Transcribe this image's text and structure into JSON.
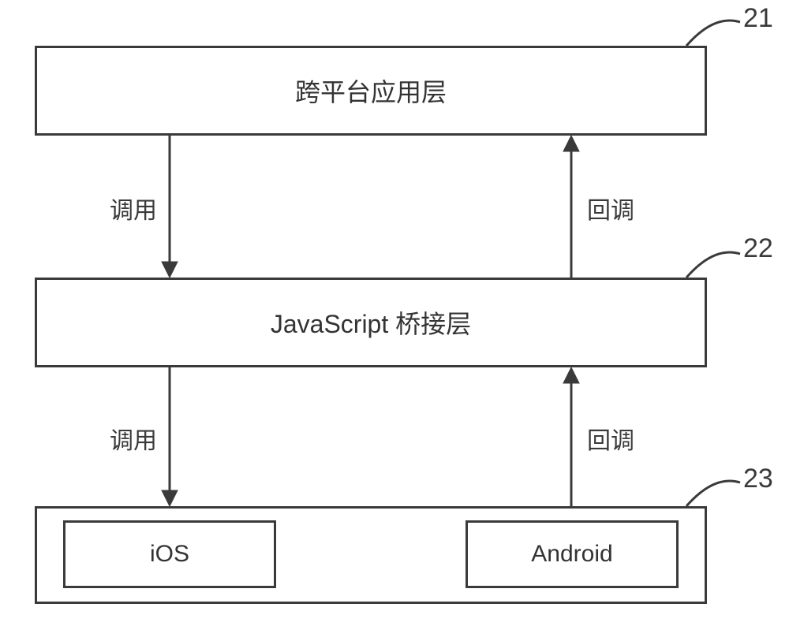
{
  "boxes": {
    "app_layer": {
      "label": "跨平台应用层",
      "ref": "21"
    },
    "bridge_layer": {
      "label": "JavaScript 桥接层",
      "ref": "22"
    },
    "native_layer": {
      "ref": "23",
      "ios": {
        "label": "iOS"
      },
      "android": {
        "label": "Android"
      }
    }
  },
  "arrows": {
    "app_to_bridge": {
      "label": "调用"
    },
    "bridge_to_app": {
      "label": "回调"
    },
    "bridge_to_native": {
      "label": "调用"
    },
    "native_to_bridge": {
      "label": "回调"
    }
  }
}
